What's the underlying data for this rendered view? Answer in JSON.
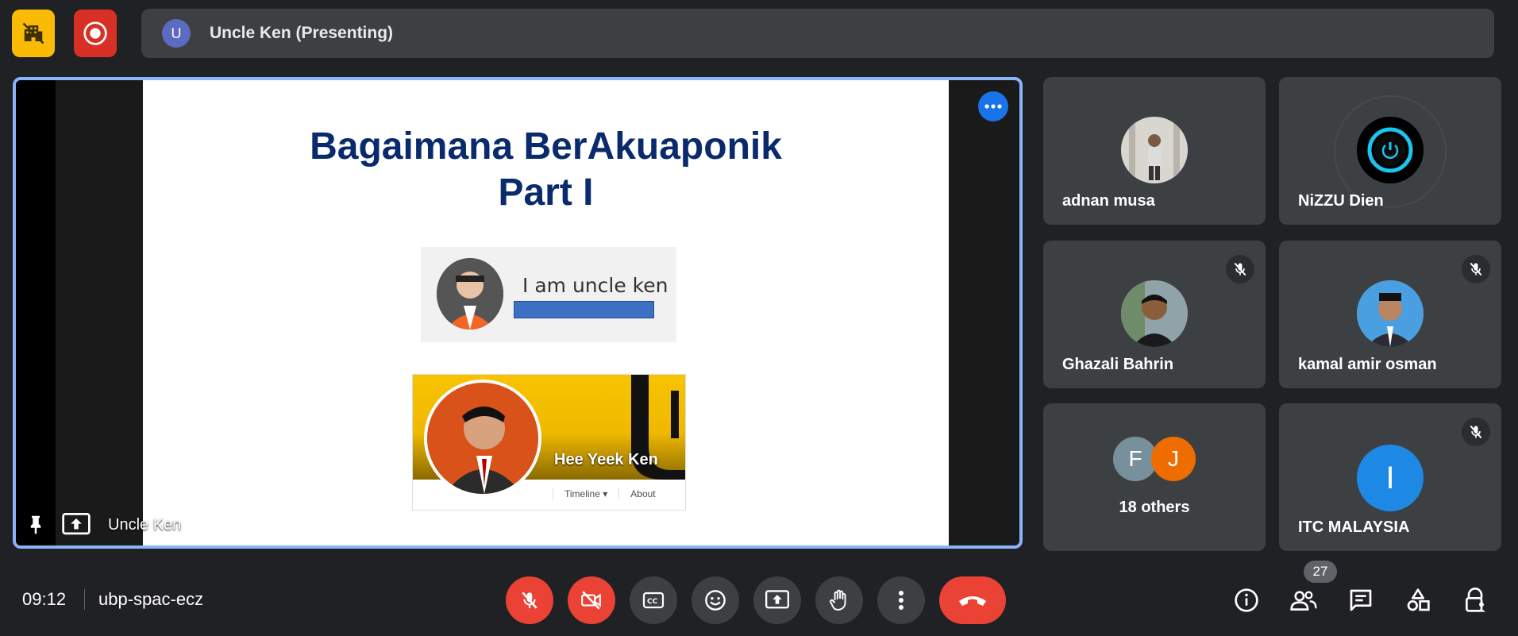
{
  "presenter": {
    "avatar_letter": "U",
    "label": "Uncle Ken (Presenting)"
  },
  "stage": {
    "slide_title_line1": "Bagaimana BerAkuaponik",
    "slide_title_line2": "Part I",
    "card1_text": "I am uncle ken",
    "card2_name": "Hee Yeek Ken",
    "card2_tab1": "Timeline ▾",
    "card2_tab2": "About",
    "footer_label": "Uncle Ken"
  },
  "participants": [
    {
      "name": "adnan musa",
      "muted": false
    },
    {
      "name": "NiZZU Dien",
      "muted": false
    },
    {
      "name": "Ghazali Bahrin",
      "muted": true
    },
    {
      "name": "kamal amir osman",
      "muted": true
    },
    {
      "name": "18 others",
      "letters": [
        "F",
        "J"
      ]
    },
    {
      "name": "ITC MALAYSIA",
      "letter": "I",
      "muted": true
    }
  ],
  "meeting": {
    "time": "09:12",
    "code": "ubp-spac-ecz",
    "people_count": "27"
  },
  "colors": {
    "accent": "#8ab4f8",
    "danger": "#ea4335",
    "tile": "#3c4043",
    "bg": "#202124"
  }
}
